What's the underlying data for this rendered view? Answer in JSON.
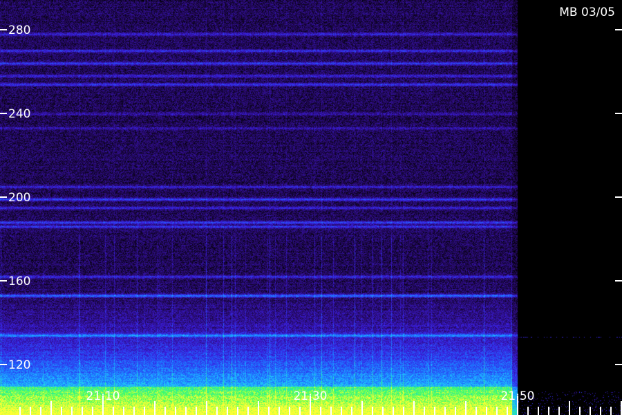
{
  "title": "MB 03/05",
  "chart_data": {
    "type": "heatmap",
    "title": "MB 03/05",
    "xlabel": "",
    "ylabel": "",
    "y_ticks": [
      120,
      160,
      200,
      240,
      280
    ],
    "y_range": [
      106,
      293
    ],
    "x_tick_labels": [
      "21:10",
      "21:30",
      "21:50"
    ],
    "x_range_minutes": [
      1262,
      1322
    ],
    "data_end_time": "21:50",
    "colormap": [
      "#000000",
      "#2a0a6e",
      "#3a1ee0",
      "#1e6cff",
      "#1ec8ff",
      "#33ff66",
      "#ffff33"
    ],
    "bands": [
      {
        "freq": 278,
        "level": 0.55
      },
      {
        "freq": 270,
        "level": 0.65
      },
      {
        "freq": 264,
        "level": 0.75
      },
      {
        "freq": 258,
        "level": 0.55
      },
      {
        "freq": 254,
        "level": 0.7
      },
      {
        "freq": 240,
        "level": 0.35
      },
      {
        "freq": 233,
        "level": 0.4
      },
      {
        "freq": 205,
        "level": 0.5
      },
      {
        "freq": 199,
        "level": 0.8
      },
      {
        "freq": 195,
        "level": 0.55
      },
      {
        "freq": 188,
        "level": 0.75
      },
      {
        "freq": 186,
        "level": 0.7
      },
      {
        "freq": 162,
        "level": 0.6
      },
      {
        "freq": 153,
        "level": 0.95
      },
      {
        "freq": 134,
        "level": 0.8
      }
    ]
  }
}
